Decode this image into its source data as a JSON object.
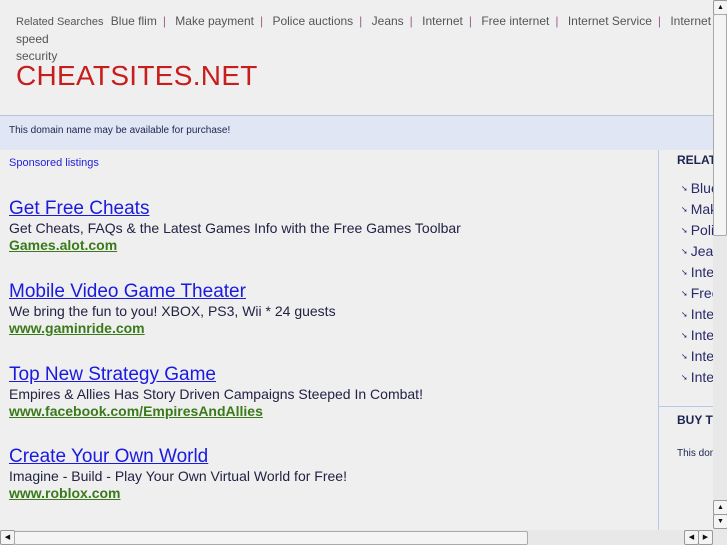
{
  "related_searches": {
    "label": "Related Searches",
    "items": [
      "Blue flim",
      "Make payment",
      "Police auctions",
      "Jeans",
      "Internet",
      "Free internet",
      "Internet Service",
      "Internet speed"
    ],
    "wrapped": "security"
  },
  "site_title": "CHEATSITES.NET",
  "domain_notice": "This domain name may be available for purchase!",
  "sponsored_label": "Sponsored listings",
  "ads": [
    {
      "title": "Get Free Cheats",
      "desc": "Get Cheats, FAQs & the Latest Games Info with the Free Games Toolbar",
      "url": "Games.alot.com"
    },
    {
      "title": "Mobile Video Game Theater",
      "desc": "We bring the fun to you! XBOX, PS3, Wii * 24 guests",
      "url": "www.gaminride.com"
    },
    {
      "title": "Top New Strategy Game",
      "desc": "Empires & Allies Has Story Driven Campaigns Steeped In Combat!",
      "url": "www.facebook.com/EmpiresAndAllies"
    },
    {
      "title": "Create Your Own World",
      "desc": "Imagine - Build - Play Your Own Virtual World for Free!",
      "url": "www.roblox.com"
    }
  ],
  "sidebar": {
    "related_heading": "RELATED",
    "items": [
      "Blue flim",
      "Make payment",
      "Police auctions",
      "Jeans",
      "Internet",
      "Free internet",
      "Internet Service",
      "Internet speed",
      "Inte",
      "Internet security"
    ],
    "buy_heading": "BUY THIS",
    "buy_text": "This domain"
  }
}
